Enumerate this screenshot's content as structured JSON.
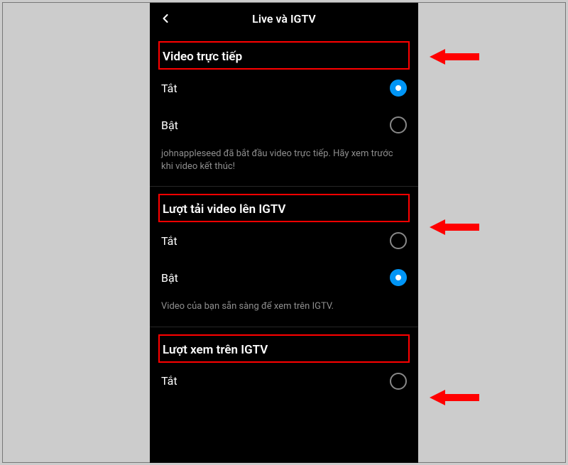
{
  "header": {
    "title": "Live và IGTV"
  },
  "sections": [
    {
      "title": "Video trực tiếp",
      "options": [
        {
          "label": "Tắt",
          "checked": true
        },
        {
          "label": "Bật",
          "checked": false
        }
      ],
      "description": "johnappleseed đã bắt đầu video trực tiếp. Hãy xem trước khi video kết thúc!"
    },
    {
      "title": "Lượt tải video lên IGTV",
      "options": [
        {
          "label": "Tắt",
          "checked": false
        },
        {
          "label": "Bật",
          "checked": true
        }
      ],
      "description": "Video của bạn sẵn sàng để xem trên IGTV."
    },
    {
      "title": "Lượt xem trên IGTV",
      "options": [
        {
          "label": "Tắt",
          "checked": false
        }
      ]
    }
  ],
  "annotations": {
    "highlight_color": "#ff0000",
    "arrow_color": "#ff0000"
  }
}
